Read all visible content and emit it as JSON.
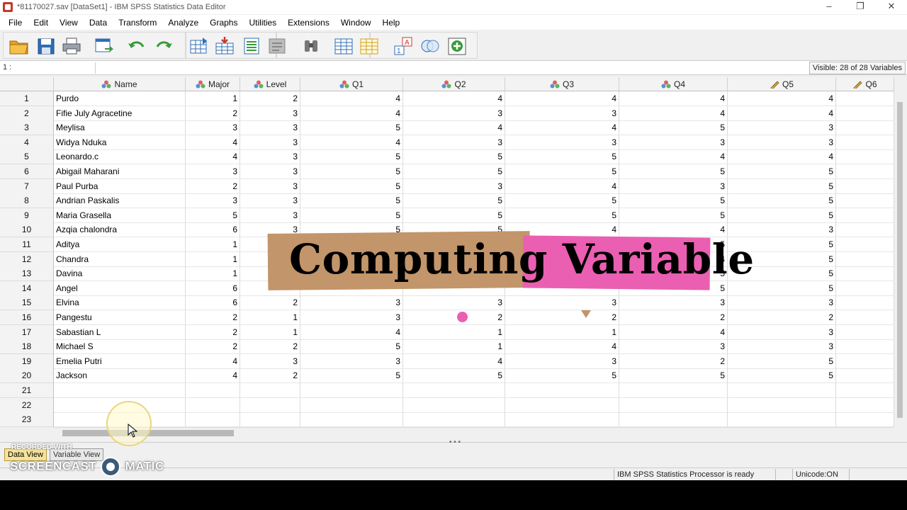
{
  "window": {
    "title": "*81170027.sav [DataSet1] - IBM SPSS Statistics Data Editor",
    "controls": [
      "–",
      "❐",
      "✕"
    ]
  },
  "menubar": [
    "File",
    "Edit",
    "View",
    "Data",
    "Transform",
    "Analyze",
    "Graphs",
    "Utilities",
    "Extensions",
    "Window",
    "Help"
  ],
  "toolbar": {
    "buttons": [
      "open-icon",
      "save-icon",
      "print-icon",
      "recall-dialog-icon",
      "undo-icon",
      "redo-icon",
      "goto-case-icon",
      "goto-variable-icon",
      "variables-icon",
      "run-descriptives-icon",
      "find-icon",
      "insert-cases-icon",
      "insert-variable-icon",
      "split-file-icon",
      "weight-cases-icon",
      "select-cases-icon",
      "value-labels-icon",
      "use-sets-icon"
    ],
    "colors": {
      "accent_orange": "#e8a020",
      "accent_blue": "#2f6db5",
      "accent_green": "#3a9a3a",
      "accent_red": "#c8392b"
    }
  },
  "refbar": {
    "cell_ref": "1 :",
    "visible_label": "Visible: 28 of 28 Variables"
  },
  "grid": {
    "columns": [
      {
        "name": "Name",
        "type": "nominal"
      },
      {
        "name": "Major",
        "type": "nominal"
      },
      {
        "name": "Level",
        "type": "nominal"
      },
      {
        "name": "Q1",
        "type": "nominal"
      },
      {
        "name": "Q2",
        "type": "nominal"
      },
      {
        "name": "Q3",
        "type": "nominal"
      },
      {
        "name": "Q4",
        "type": "nominal"
      },
      {
        "name": "Q5",
        "type": "scale"
      },
      {
        "name": "Q6",
        "type": "scale"
      }
    ],
    "rows": [
      [
        "Purdo",
        "1",
        "2",
        "4",
        "4",
        "4",
        "4",
        "4",
        ""
      ],
      [
        "Fifie July Agracetine",
        "2",
        "3",
        "4",
        "3",
        "3",
        "4",
        "4",
        ""
      ],
      [
        "Meylisa",
        "3",
        "3",
        "5",
        "4",
        "4",
        "5",
        "3",
        ""
      ],
      [
        "Widya Nduka",
        "4",
        "3",
        "4",
        "3",
        "3",
        "3",
        "3",
        ""
      ],
      [
        "Leonardo.c",
        "4",
        "3",
        "5",
        "5",
        "5",
        "4",
        "4",
        ""
      ],
      [
        "Abigail Maharani",
        "3",
        "3",
        "5",
        "5",
        "5",
        "5",
        "5",
        ""
      ],
      [
        "Paul Purba",
        "2",
        "3",
        "5",
        "3",
        "4",
        "3",
        "5",
        ""
      ],
      [
        "Andrian Paskalis",
        "3",
        "3",
        "5",
        "5",
        "5",
        "5",
        "5",
        ""
      ],
      [
        "Maria Grasella",
        "5",
        "3",
        "5",
        "5",
        "5",
        "5",
        "5",
        ""
      ],
      [
        "Azqia chalondra",
        "6",
        "3",
        "5",
        "5",
        "4",
        "4",
        "3",
        ""
      ],
      [
        "Aditya",
        "1",
        "",
        "",
        "",
        "",
        "5",
        "5",
        ""
      ],
      [
        "Chandra",
        "1",
        "",
        "",
        "",
        "",
        "4",
        "5",
        ""
      ],
      [
        "Davina",
        "1",
        "",
        "",
        "",
        "",
        "5",
        "5",
        ""
      ],
      [
        "Angel",
        "6",
        "",
        "",
        "",
        "",
        "5",
        "5",
        ""
      ],
      [
        "Elvina",
        "6",
        "2",
        "3",
        "3",
        "3",
        "3",
        "3",
        ""
      ],
      [
        "Pangestu",
        "2",
        "1",
        "3",
        "2",
        "2",
        "2",
        "2",
        ""
      ],
      [
        "Sabastian L",
        "2",
        "1",
        "4",
        "1",
        "1",
        "4",
        "3",
        ""
      ],
      [
        "Michael S",
        "2",
        "2",
        "5",
        "1",
        "4",
        "3",
        "3",
        ""
      ],
      [
        "Emelia Putri",
        "4",
        "3",
        "3",
        "4",
        "3",
        "2",
        "5",
        ""
      ],
      [
        "Jackson",
        "4",
        "2",
        "5",
        "5",
        "5",
        "5",
        "5",
        ""
      ],
      [
        "",
        "",
        "",
        "",
        "",
        "",
        "",
        "",
        ""
      ],
      [
        "",
        "",
        "",
        "",
        "",
        "",
        "",
        "",
        ""
      ],
      [
        "",
        "",
        "",
        "",
        "",
        "",
        "",
        "",
        ""
      ]
    ]
  },
  "tabs": {
    "data_view": "Data View",
    "variable_view": "Variable View"
  },
  "status": {
    "processor": "IBM SPSS Statistics Processor is ready",
    "unicode": "Unicode:ON"
  },
  "watermark": {
    "recorded": "RECORDED WITH",
    "brand": "SCREENCAST",
    "brand2": "MATIC"
  },
  "overlay": {
    "word1": "Computing",
    "word2": "Variable",
    "colors": {
      "tan": "#c2956a",
      "pink": "#ea5fb1"
    }
  }
}
